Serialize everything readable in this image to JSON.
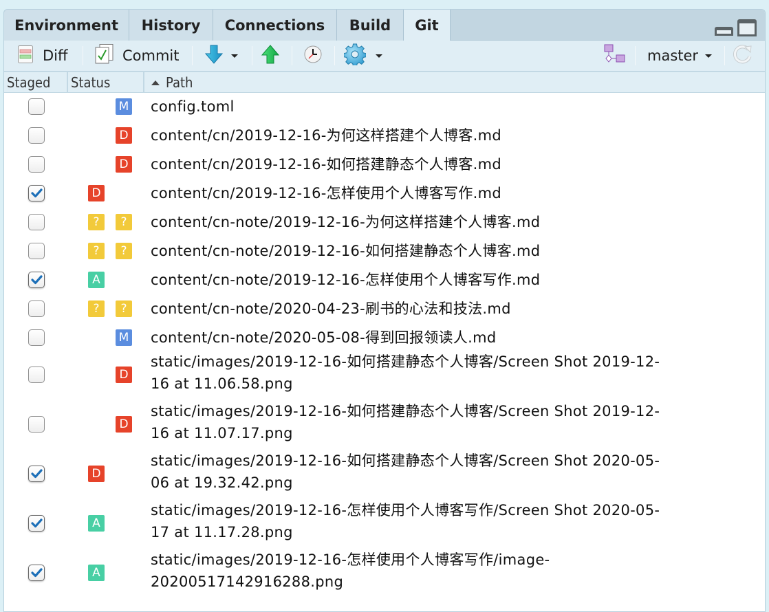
{
  "tabs": [
    {
      "label": "Environment",
      "active": false
    },
    {
      "label": "History",
      "active": false
    },
    {
      "label": "Connections",
      "active": false
    },
    {
      "label": "Build",
      "active": false
    },
    {
      "label": "Git",
      "active": true
    }
  ],
  "window_controls": {
    "minimize_icon": "minimize-pane-icon",
    "maximize_icon": "maximize-pane-icon"
  },
  "toolbar": {
    "diff_label": "Diff",
    "commit_label": "Commit",
    "pull_icon": "pull-down-arrow-icon",
    "push_icon": "push-up-arrow-icon",
    "history_icon": "clock-icon",
    "more_icon": "gear-icon",
    "branch_icon": "new-branch-icon",
    "branch_label": "master",
    "refresh_icon": "refresh-icon"
  },
  "columns": {
    "staged": "Staged",
    "status": "Status",
    "path": "Path",
    "sort": "ascending"
  },
  "status_colors": {
    "M": "#5b8ddf",
    "D": "#e6432a",
    "?": "#f2ca3a",
    "A": "#48cfa4"
  },
  "files": [
    {
      "staged": false,
      "staged_status": "",
      "unstaged_status": "M",
      "path": "config.toml"
    },
    {
      "staged": false,
      "staged_status": "",
      "unstaged_status": "D",
      "path": "content/cn/2019-12-16-为何这样搭建个人博客.md"
    },
    {
      "staged": false,
      "staged_status": "",
      "unstaged_status": "D",
      "path": "content/cn/2019-12-16-如何搭建静态个人博客.md"
    },
    {
      "staged": true,
      "staged_status": "D",
      "unstaged_status": "",
      "path": "content/cn/2019-12-16-怎样使用个人博客写作.md"
    },
    {
      "staged": false,
      "staged_status": "?",
      "unstaged_status": "?",
      "path": "content/cn-note/2019-12-16-为何这样搭建个人博客.md"
    },
    {
      "staged": false,
      "staged_status": "?",
      "unstaged_status": "?",
      "path": "content/cn-note/2019-12-16-如何搭建静态个人博客.md"
    },
    {
      "staged": true,
      "staged_status": "A",
      "unstaged_status": "",
      "path": "content/cn-note/2019-12-16-怎样使用个人博客写作.md"
    },
    {
      "staged": false,
      "staged_status": "?",
      "unstaged_status": "?",
      "path": "content/cn-note/2020-04-23-刷书的心法和技法.md"
    },
    {
      "staged": false,
      "staged_status": "",
      "unstaged_status": "M",
      "path": "content/cn-note/2020-05-08-得到回报领读人.md"
    },
    {
      "staged": false,
      "staged_status": "",
      "unstaged_status": "D",
      "path": "static/images/2019-12-16-如何搭建静态个人博客/Screen Shot 2019-12-16 at 11.06.58.png",
      "lines": [
        "static/images/2019-12-16-如何搭建静态个人博客/Screen Shot 2019-12-",
        "16 at 11.06.58.png"
      ]
    },
    {
      "staged": false,
      "staged_status": "",
      "unstaged_status": "D",
      "path": "static/images/2019-12-16-如何搭建静态个人博客/Screen Shot 2019-12-16 at 11.07.17.png",
      "lines": [
        "static/images/2019-12-16-如何搭建静态个人博客/Screen Shot 2019-12-",
        "16 at 11.07.17.png"
      ]
    },
    {
      "staged": true,
      "staged_status": "D",
      "unstaged_status": "",
      "path": "static/images/2019-12-16-如何搭建静态个人博客/Screen Shot 2020-05-06 at 19.32.42.png",
      "lines": [
        "static/images/2019-12-16-如何搭建静态个人博客/Screen Shot 2020-05-",
        "06 at 19.32.42.png"
      ]
    },
    {
      "staged": true,
      "staged_status": "A",
      "unstaged_status": "",
      "path": "static/images/2019-12-16-怎样使用个人博客写作/Screen Shot 2020-05-17 at 11.17.28.png",
      "lines": [
        "static/images/2019-12-16-怎样使用个人博客写作/Screen Shot 2020-05-",
        "17 at 11.17.28.png"
      ]
    },
    {
      "staged": true,
      "staged_status": "A",
      "unstaged_status": "",
      "path": "static/images/2019-12-16-怎样使用个人博客写作/image-20200517142916288.png",
      "lines": [
        "static/images/2019-12-16-怎样使用个人博客写作/image-",
        "20200517142916288.png"
      ]
    }
  ]
}
